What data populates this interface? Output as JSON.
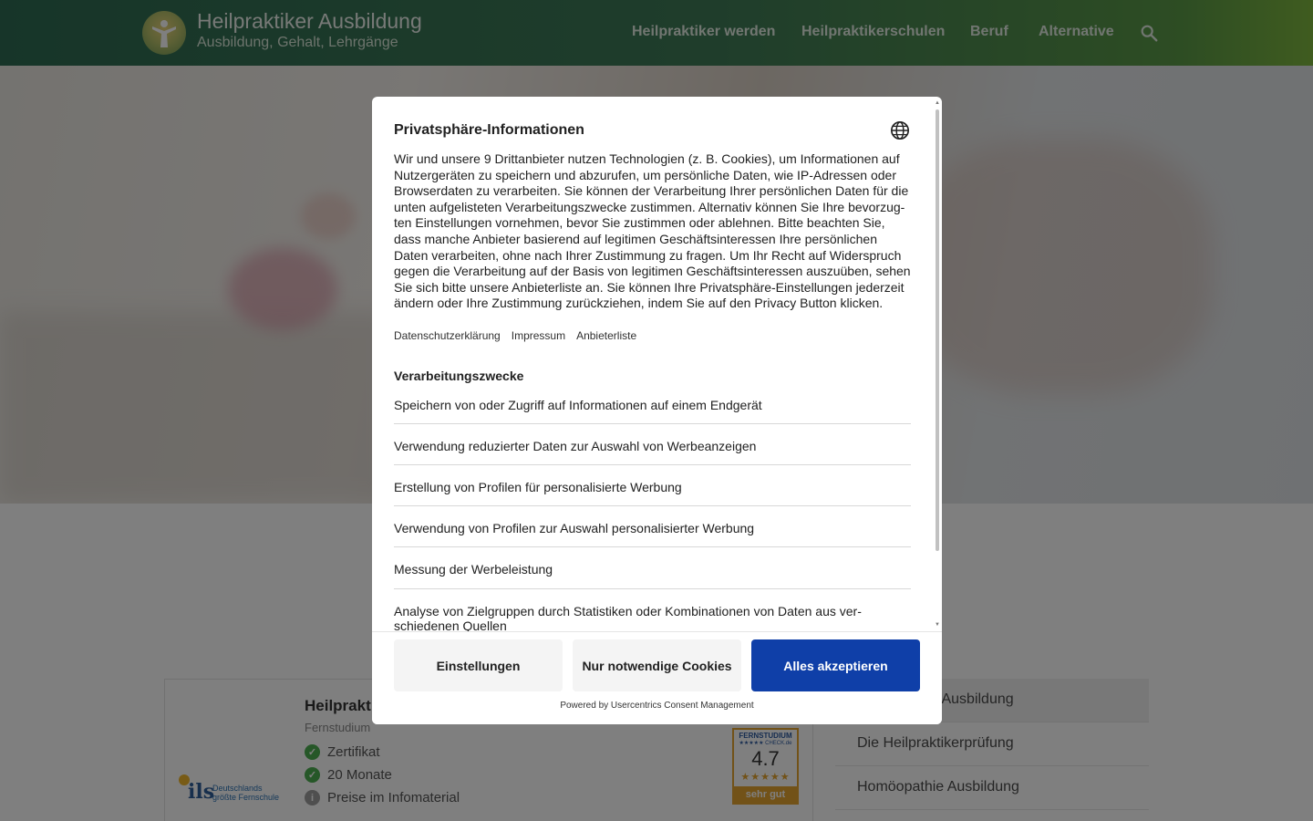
{
  "header": {
    "title": "Heilpraktiker Ausbildung",
    "subtitle": "Ausbildung, Gehalt, Lehrgänge",
    "nav": [
      "Heilpraktiker werden",
      "Heilpraktikerschulen",
      "Beruf",
      "Alternative"
    ],
    "search_icon": "search-icon"
  },
  "card": {
    "title": "Heilprakt",
    "subtitle": "Fernstudium",
    "provider_logo_text": "ils",
    "provider_tagline": [
      "Deutschlands",
      "größte Fernschule"
    ],
    "features": [
      {
        "icon": "check-icon",
        "text": "Zertifikat",
        "color": "#4caf50"
      },
      {
        "icon": "check-icon",
        "text": "20 Monate",
        "color": "#4caf50"
      },
      {
        "icon": "info-icon",
        "text": "Preise im Infomaterial",
        "color": "#9e9e9e"
      }
    ],
    "badge": {
      "brand": "FERNSTUDIUM",
      "brand2": "★★★★★ CHECK.de",
      "score": "4.7",
      "stars": "★★★★★",
      "verdict": "sehr gut"
    }
  },
  "sidebar": {
    "items": [
      {
        "label": "Heilpraktiker Ausbildung",
        "active": true
      },
      {
        "label": "Die Heilpraktikerprüfung",
        "active": false
      },
      {
        "label": "Homöopathie Ausbildung",
        "active": false
      }
    ]
  },
  "consent": {
    "title": "Privatsphäre-Informationen",
    "globe_icon": "globe-icon",
    "body": "Wir und unsere 9 Drittanbieter nutzen Technologien (z. B. Cookies), um Informationen auf Nutzergeräten zu speichern und abzurufen, um persönliche Daten, wie IP-Adressen oder Browserdaten zu verarbeiten. Sie können der Verarbeitung Ihrer persönlichen Daten für die unten aufgelisteten Verarbeitungszwecke zustimmen. Alternativ können Sie Ihre bevorzug­ten Einstellungen vornehmen, bevor Sie zustimmen oder ablehnen. Bitte beachten Sie, dass manche Anbieter basierend auf legitimen Geschäftsinteressen Ihre persönlichen Daten ver­arbeiten, ohne nach Ihrer Zustimmung zu fragen. Um Ihr Recht auf Widerspruch gegen die Verarbeitung auf der Basis von legitimen Geschäftsinteressen auszuüben, sehen Sie sich bitte unsere Anbieterliste an. Sie können Ihre Privatsphäre-Einstellungen jederzeit ändern oder Ihre Zustimmung zurückziehen, indem Sie auf den Privacy Button klicken.",
    "links": [
      "Datenschutzerklärung",
      "Impressum",
      "Anbieterliste"
    ],
    "purposes_heading": "Verarbeitungszwecke",
    "purposes": [
      "Speichern von oder Zugriff auf Informationen auf einem Endgerät",
      "Verwendung reduzierter Daten zur Auswahl von Werbeanzeigen",
      "Erstellung von Profilen für personalisierte Werbung",
      "Verwendung von Profilen zur Auswahl personalisierter Werbung",
      "Messung der Werbeleistung",
      "Analyse von Zielgruppen durch Statistiken oder Kombinationen von Daten aus ver­schiedenen Quellen"
    ],
    "buttons": {
      "settings": "Einstellungen",
      "necessary": "Nur notwendige Cookies",
      "accept_all": "Alles akzeptieren"
    },
    "powered_by": "Powered by Usercentrics Consent Management"
  },
  "colors": {
    "primary_button": "#0f3fa8",
    "header_gradient_start": "#2e6b52",
    "header_gradient_end": "#7fb83f"
  }
}
